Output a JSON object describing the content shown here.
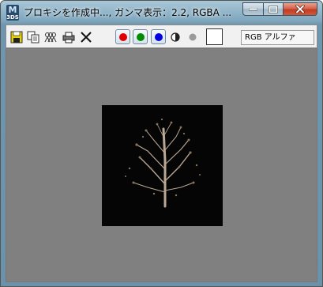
{
  "window": {
    "title": "プロキシを作成中..., ガンマ表示：2.2, RGBA ...",
    "app_icon_letter": "M",
    "app_icon_sub": "3DS"
  },
  "toolbar": {
    "icons": [
      "save-icon",
      "copy-icon",
      "clone-icon",
      "print-icon",
      "clear-icon"
    ],
    "channel_buttons": [
      {
        "name": "red-channel",
        "color": "#e00000"
      },
      {
        "name": "green-channel",
        "color": "#008a00"
      },
      {
        "name": "blue-channel",
        "color": "#0000e0"
      }
    ],
    "channel_display_value": "RGB アルファ"
  },
  "viewport": {
    "background": "#808080",
    "render_background": "#050505"
  }
}
